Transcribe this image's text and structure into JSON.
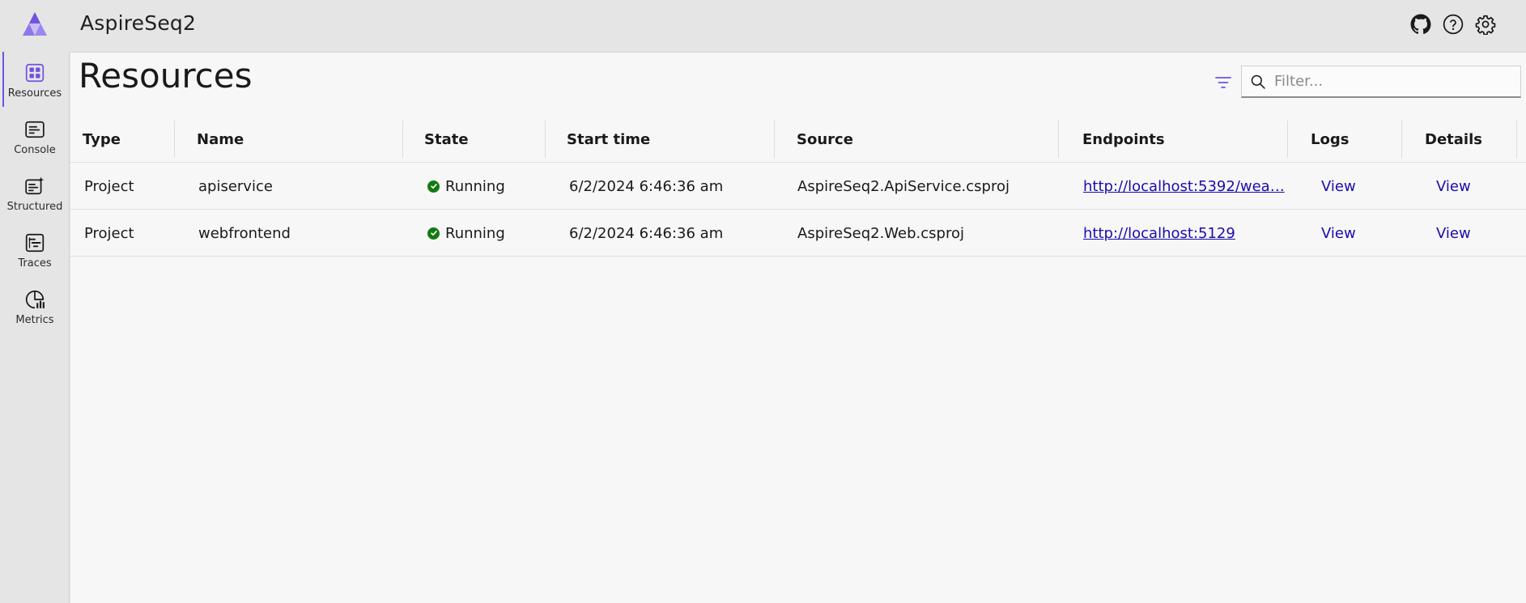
{
  "app": {
    "title": "AspireSeq2",
    "brand_color": "#7153e0"
  },
  "header": {
    "icons": [
      "github-icon",
      "help-icon",
      "settings-icon"
    ]
  },
  "sidebar": {
    "items": [
      {
        "label": "Resources",
        "icon": "resources-icon",
        "active": true
      },
      {
        "label": "Console",
        "icon": "console-icon",
        "active": false
      },
      {
        "label": "Structured",
        "icon": "structured-icon",
        "active": false
      },
      {
        "label": "Traces",
        "icon": "traces-icon",
        "active": false
      },
      {
        "label": "Metrics",
        "icon": "metrics-icon",
        "active": false
      }
    ]
  },
  "main": {
    "title": "Resources",
    "search": {
      "placeholder": "Filter...",
      "value": ""
    },
    "table": {
      "columns": [
        "Type",
        "Name",
        "State",
        "Start time",
        "Source",
        "Endpoints",
        "Logs",
        "Details"
      ],
      "rows": [
        {
          "type": "Project",
          "name": "apiservice",
          "state": "Running",
          "start_time": "6/2/2024 6:46:36 am",
          "source": "AspireSeq2.ApiService.csproj",
          "endpoint": "http://localhost:5392/wea…",
          "logs": "View",
          "details": "View"
        },
        {
          "type": "Project",
          "name": "webfrontend",
          "state": "Running",
          "start_time": "6/2/2024 6:46:36 am",
          "source": "AspireSeq2.Web.csproj",
          "endpoint": "http://localhost:5129",
          "logs": "View",
          "details": "View"
        }
      ]
    }
  },
  "colors": {
    "running": "#127a12",
    "link": "#1a0dab"
  }
}
